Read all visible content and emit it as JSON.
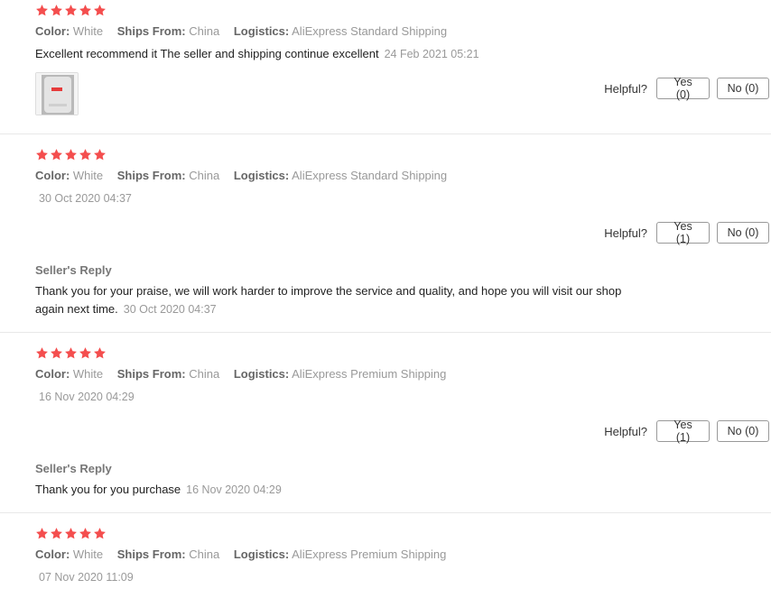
{
  "icons": {
    "star": "star-icon"
  },
  "colors": {
    "star": "#f44e4e",
    "meta_value": "#999999",
    "divider": "#e8e8e8"
  },
  "labels": {
    "color": "Color:",
    "ships_from": "Ships From:",
    "logistics": "Logistics:",
    "helpful": "Helpful?",
    "seller_reply": "Seller's Reply"
  },
  "reviews": [
    {
      "rating": 5,
      "color": "White",
      "ships_from": "China",
      "logistics": "AliExpress Standard Shipping",
      "text": "Excellent recommend it The seller and shipping continue excellent",
      "date": "24 Feb 2021 05:21",
      "yes": "Yes (0)",
      "no": "No (0)"
    },
    {
      "rating": 5,
      "color": "White",
      "ships_from": "China",
      "logistics": "AliExpress Standard Shipping",
      "date": "30 Oct 2020 04:37",
      "yes": "Yes (1)",
      "no": "No (0)",
      "reply_line1": "Thank you for your praise, we will work harder to improve the service and quality, and hope you will visit our shop",
      "reply_line2": "again next time.",
      "reply_date": "30 Oct 2020 04:37"
    },
    {
      "rating": 5,
      "color": "White",
      "ships_from": "China",
      "logistics": "AliExpress Premium Shipping",
      "date": "16 Nov 2020 04:29",
      "yes": "Yes (1)",
      "no": "No (0)",
      "reply_text": "Thank you for you purchase",
      "reply_date": "16 Nov 2020 04:29"
    },
    {
      "rating": 5,
      "color": "White",
      "ships_from": "China",
      "logistics": "AliExpress Premium Shipping",
      "date": "07 Nov 2020 11:09"
    }
  ]
}
